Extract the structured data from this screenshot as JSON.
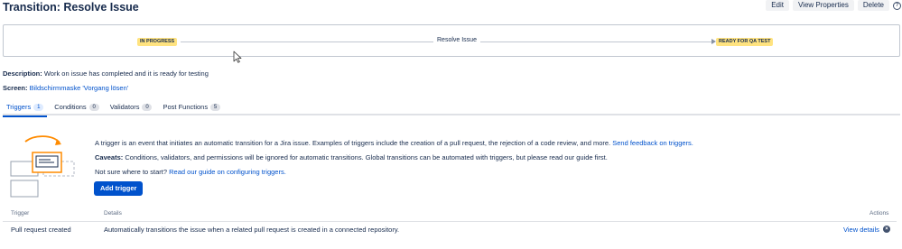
{
  "page": {
    "title": "Transition: Resolve Issue"
  },
  "toolbar": {
    "edit_label": "Edit",
    "view_properties_label": "View Properties",
    "delete_label": "Delete"
  },
  "workflow": {
    "from_status": "IN PROGRESS",
    "transition_name": "Resolve Issue",
    "to_status": "READY FOR QA TEST",
    "status_color": "#ffe380"
  },
  "details": {
    "description_label": "Description:",
    "description_value": "Work on issue has completed and it is ready for testing",
    "screen_label": "Screen:",
    "screen_value": "Bildschirmmaske 'Vorgang lösen'"
  },
  "tabs": [
    {
      "label": "Triggers",
      "count": "1",
      "active": true
    },
    {
      "label": "Conditions",
      "count": "0"
    },
    {
      "label": "Validators",
      "count": "0"
    },
    {
      "label": "Post Functions",
      "count": "5"
    }
  ],
  "triggers_info": {
    "intro_text": "A trigger is an event that initiates an automatic transition for a Jira issue. Examples of triggers include the creation of a pull request, the rejection of a code review, and more.",
    "feedback_link": "Send feedback on triggers.",
    "caveats_label": "Caveats:",
    "caveats_text": "Conditions, validators, and permissions will be ignored for automatic transitions. Global transitions can be automated with triggers, but please read our guide first.",
    "start_text": "Not sure where to start?",
    "guide_link": "Read our guide on configuring triggers.",
    "add_button_label": "Add trigger"
  },
  "table": {
    "headers": {
      "trigger": "Trigger",
      "details": "Details",
      "actions": "Actions"
    },
    "rows": [
      {
        "trigger": "Pull request created",
        "details": "Automatically transitions the issue when a related pull request is created in a connected repository.",
        "action_label": "View details"
      }
    ]
  },
  "colors": {
    "primary": "#0052cc",
    "text": "#172b4d",
    "muted": "#5e6c84",
    "border": "#dfe1e6"
  }
}
